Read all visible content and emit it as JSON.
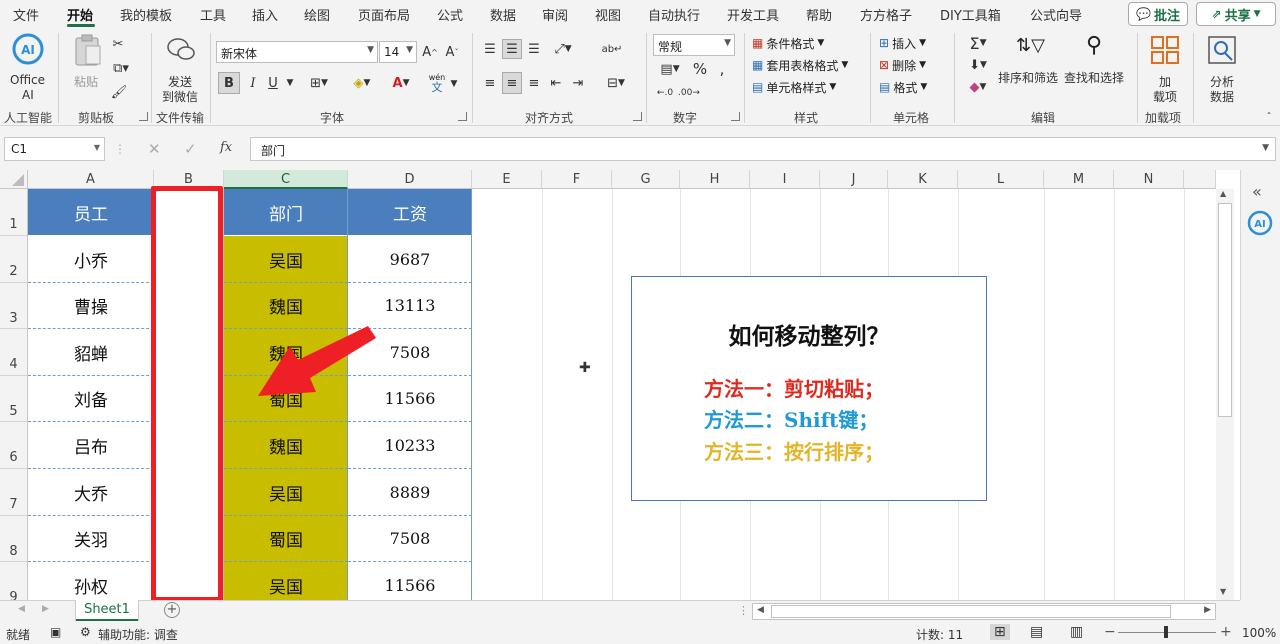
{
  "menu": {
    "items": [
      "文件",
      "开始",
      "我的模板",
      "工具",
      "插入",
      "绘图",
      "页面布局",
      "公式",
      "数据",
      "审阅",
      "视图",
      "自动执行",
      "开发工具",
      "帮助",
      "方方格子",
      "DIY工具箱",
      "公式向导"
    ],
    "active_index": 1,
    "comment_button": "批注",
    "share_button": "共享"
  },
  "ribbon": {
    "office_ai": {
      "line1": "Office",
      "line2": "AI",
      "group": "人工智能"
    },
    "clipboard": {
      "paste": "粘贴",
      "group": "剪贴板"
    },
    "file_transfer": {
      "line1": "发送",
      "line2": "到微信",
      "group": "文件传输"
    },
    "font": {
      "name": "新宋体",
      "size": "14",
      "bold": "B",
      "italic": "I",
      "underline": "U",
      "phonetic_top": "wén",
      "phonetic_bottom": "文",
      "group": "字体"
    },
    "alignment": {
      "group": "对齐方式"
    },
    "number": {
      "format": "常规",
      "group": "数字"
    },
    "styles": {
      "conditional": "条件格式",
      "table_format": "套用表格格式",
      "cell_style": "单元格样式",
      "group": "样式"
    },
    "cells": {
      "insert": "插入",
      "delete": "删除",
      "format": "格式",
      "group": "单元格"
    },
    "editing": {
      "sort_filter": "排序和筛选",
      "find_select": "查找和选择",
      "group": "编辑"
    },
    "addins": {
      "line1": "加",
      "line2": "载项",
      "group": "加载项"
    },
    "analyze": {
      "line1": "分析",
      "line2": "数据"
    }
  },
  "formula_bar": {
    "name_box": "C1",
    "fx": "fx",
    "content": "部门"
  },
  "columns": [
    "A",
    "B",
    "C",
    "D",
    "E",
    "F",
    "G",
    "H",
    "I",
    "J",
    "K",
    "L",
    "M",
    "N"
  ],
  "rows": [
    "1",
    "2",
    "3",
    "4",
    "5",
    "6",
    "7",
    "8",
    "9"
  ],
  "table": {
    "headers": {
      "employee": "员工",
      "dept": "部门",
      "salary": "工资"
    },
    "records": [
      {
        "employee": "小乔",
        "dept": "吴国",
        "salary": "9687"
      },
      {
        "employee": "曹操",
        "dept": "魏国",
        "salary": "13113"
      },
      {
        "employee": "貂蝉",
        "dept": "魏国",
        "salary": "7508"
      },
      {
        "employee": "刘备",
        "dept": "蜀国",
        "salary": "11566"
      },
      {
        "employee": "吕布",
        "dept": "魏国",
        "salary": "10233"
      },
      {
        "employee": "大乔",
        "dept": "吴国",
        "salary": "8889"
      },
      {
        "employee": "关羽",
        "dept": "蜀国",
        "salary": "7508"
      },
      {
        "employee": "孙权",
        "dept": "吴国",
        "salary": "11566"
      }
    ]
  },
  "textbox": {
    "title": "如何移动整列？",
    "method1": "方法一：剪切粘贴；",
    "method2": "方法二：Shift键；",
    "method3": "方法三：按行排序；"
  },
  "sheet_tab": "Sheet1",
  "status": {
    "ready": "就绪",
    "accessibility": "辅助功能: 调查",
    "count": "计数: 11",
    "zoom": "100%"
  },
  "colors": {
    "header_fill": "#4a7ebd",
    "dept_fill": "#c9bd00",
    "highlight": "#ee1f25",
    "accent": "#1e7145",
    "method1": "#e02a20",
    "method2": "#1f9ad6",
    "method3": "#e3b52b"
  }
}
